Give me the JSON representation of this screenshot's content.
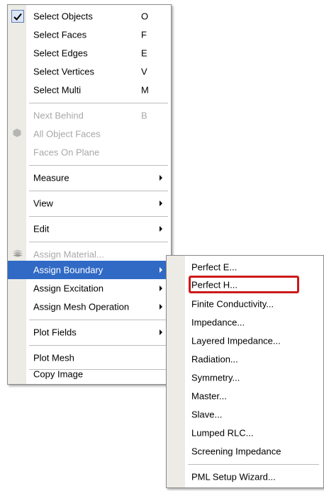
{
  "main_menu": {
    "items": [
      {
        "label": "Select Objects",
        "shortcut": "O"
      },
      {
        "label": "Select Faces",
        "shortcut": "F"
      },
      {
        "label": "Select Edges",
        "shortcut": "E"
      },
      {
        "label": "Select Vertices",
        "shortcut": "V"
      },
      {
        "label": "Select Multi",
        "shortcut": "M"
      },
      {
        "label": "Next Behind",
        "shortcut": "B"
      },
      {
        "label": "All Object Faces"
      },
      {
        "label": "Faces On Plane"
      },
      {
        "label": "Measure"
      },
      {
        "label": "View"
      },
      {
        "label": "Edit"
      },
      {
        "label": "Assign Material..."
      },
      {
        "label": "Assign Boundary"
      },
      {
        "label": "Assign Excitation"
      },
      {
        "label": "Assign Mesh Operation"
      },
      {
        "label": "Plot Fields"
      },
      {
        "label": "Plot Mesh"
      },
      {
        "label": "Copy Image"
      }
    ]
  },
  "sub_menu": {
    "items": [
      {
        "label": "Perfect E..."
      },
      {
        "label": "Perfect H..."
      },
      {
        "label": "Finite Conductivity..."
      },
      {
        "label": "Impedance..."
      },
      {
        "label": "Layered Impedance..."
      },
      {
        "label": "Radiation..."
      },
      {
        "label": "Symmetry..."
      },
      {
        "label": "Master..."
      },
      {
        "label": "Slave..."
      },
      {
        "label": "Lumped RLC..."
      },
      {
        "label": "Screening Impedance"
      },
      {
        "label": "PML Setup Wizard..."
      }
    ]
  },
  "colors": {
    "highlight": "#316ac5",
    "focus_box": "#cc1a1a",
    "gutter": "#ecebe5"
  }
}
